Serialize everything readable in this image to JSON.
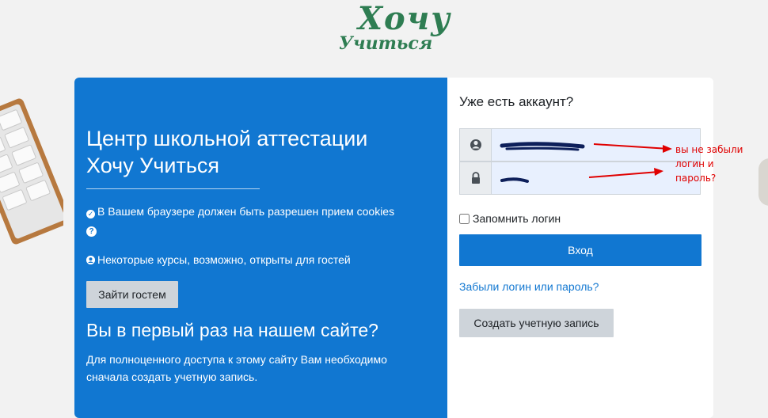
{
  "logo": {
    "line1": "Хочу",
    "line2": "Учиться"
  },
  "left_panel": {
    "title_line1": "Центр школьной аттестации",
    "title_line2": "Хочу Учиться",
    "cookies_notice": "В Вашем браузере должен быть разрешен прием cookies",
    "guest_notice": "Некоторые курсы, возможно, открыты для гостей",
    "guest_button": "Зайти гостем",
    "first_time_heading": "Вы в первый раз на нашем сайте?",
    "first_time_desc": "Для полноценного доступа к этому сайту Вам необходимо сначала создать учетную запись."
  },
  "login": {
    "heading": "Уже есть аккаунт?",
    "username_value": "",
    "password_value": "",
    "remember_label": "Запомнить логин",
    "remember_checked": false,
    "login_button": "Вход",
    "forgot_link": "Забыли логин или пароль?",
    "create_button": "Создать учетную запись"
  },
  "annotation": {
    "line1": "вы не забыли",
    "line2": "логин и",
    "line3": "пароль?"
  },
  "colors": {
    "brand_blue": "#1177d1",
    "logo_green": "#2e7d52",
    "annotation_red": "#e00000",
    "autofill_bg": "#e8f0fe"
  },
  "icons": [
    "user-icon",
    "lock-icon",
    "check-circle-icon",
    "question-circle-icon",
    "guest-user-icon"
  ]
}
